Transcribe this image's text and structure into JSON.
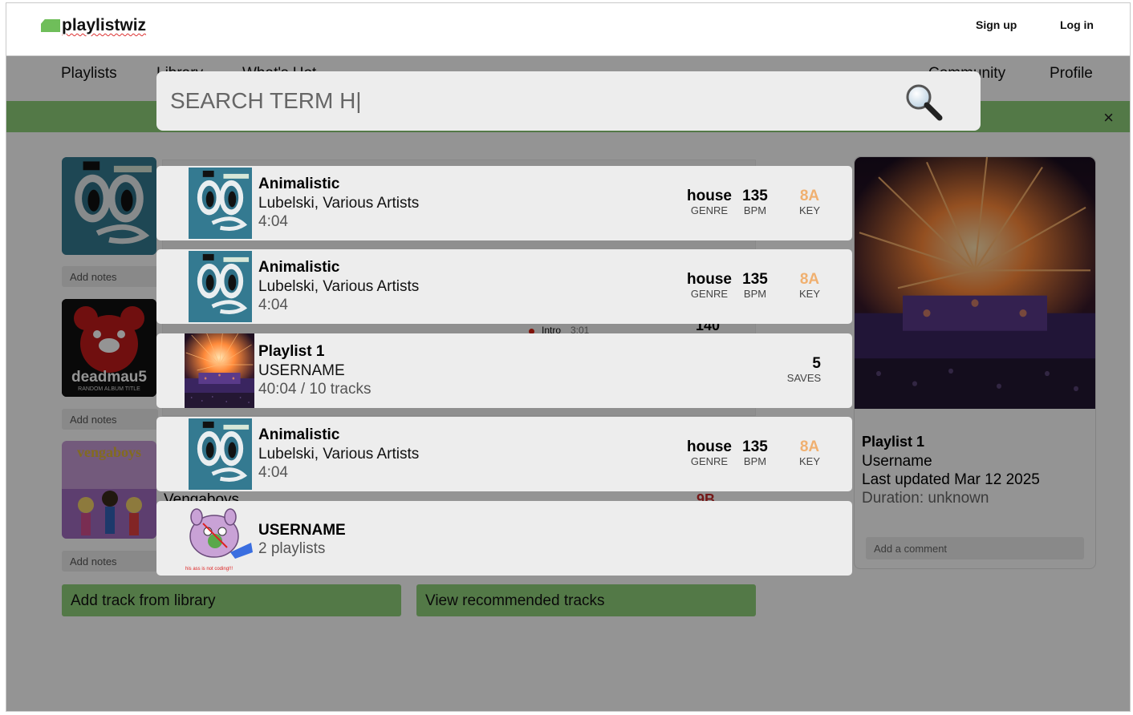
{
  "brand": {
    "name": "playlistwiz",
    "color": "#6fbe5a"
  },
  "header": {
    "sign_up": "Sign up",
    "log_in": "Log in"
  },
  "nav": {
    "items": [
      "Playlists",
      "Library",
      "What's Hot",
      "Community",
      "Profile"
    ]
  },
  "banner": {
    "close_label": "×"
  },
  "tracks_bg": {
    "notes_placeholder": "Add notes",
    "partial": {
      "intro_label": "Intro",
      "intro_time": "3:01",
      "bpm_fragment": "140",
      "key_fragment": "9B",
      "artist_fragment": "Vengaboys"
    }
  },
  "covers": [
    {
      "name": "animalistic-cover"
    },
    {
      "name": "deadmau5-cover",
      "text": "deadmau5",
      "subtext": "RANDOM ALBUM TITLE"
    },
    {
      "name": "vengaboys-cover",
      "text": "vengaboys"
    }
  ],
  "actions": {
    "add_track": "Add track from library",
    "view_recommended": "View recommended tracks"
  },
  "playlist_card": {
    "title": "Playlist 1",
    "username": "Username",
    "updated": "Last updated Mar 12 2025",
    "duration": "Duration: unknown",
    "comment_placeholder": "Add a comment"
  },
  "search": {
    "value": "SEARCH TERM H|",
    "icon": "magnifier-icon"
  },
  "results": [
    {
      "type": "track",
      "title": "Animalistic",
      "artist": "Lubelski, Various Artists",
      "duration": "4:04",
      "genre": "house",
      "genre_label": "GENRE",
      "bpm": "135",
      "bpm_label": "BPM",
      "key": "8A",
      "key_label": "KEY"
    },
    {
      "type": "track",
      "title": "Animalistic",
      "artist": "Lubelski, Various Artists",
      "duration": "4:04",
      "genre": "house",
      "genre_label": "GENRE",
      "bpm": "135",
      "bpm_label": "BPM",
      "key": "8A",
      "key_label": "KEY"
    },
    {
      "type": "playlist",
      "title": "Playlist 1",
      "owner": "USERNAME",
      "info": "40:04 / 10 tracks",
      "saves": "5",
      "saves_label": "SAVES"
    },
    {
      "type": "track",
      "title": "Animalistic",
      "artist": "Lubelski, Various Artists",
      "duration": "4:04",
      "genre": "house",
      "genre_label": "GENRE",
      "bpm": "135",
      "bpm_label": "BPM",
      "key": "8A",
      "key_label": "KEY"
    },
    {
      "type": "user",
      "name": "USERNAME",
      "info": "2 playlists",
      "avatar_caption": "his ass is not coding!!!"
    }
  ],
  "colors": {
    "accent_green": "#8fd07a",
    "key_orange": "#f0b070",
    "overlay": "rgba(0,0,0,0.42)"
  }
}
